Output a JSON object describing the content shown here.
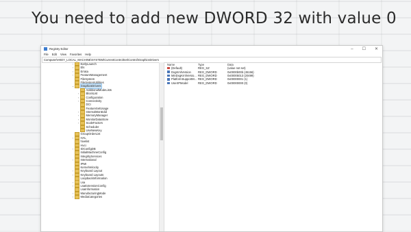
{
  "headline": "You need to add new DWORD 32 with value 0",
  "window": {
    "title": "Registry Editor",
    "controls": {
      "minimize": "–",
      "maximize": "☐",
      "close": "✕"
    },
    "menu": [
      "File",
      "Edit",
      "View",
      "Favorites",
      "Help"
    ],
    "address": "Computer\\HKEY_LOCAL_MACHINE\\SYSTEM\\CurrentControlSet\\Control\\GraphicsDrivers"
  },
  "tree": [
    {
      "label": "EarlyLaunch",
      "depth": 0,
      "expandable": true
    },
    {
      "label": "Els",
      "depth": 0,
      "expandable": true
    },
    {
      "label": "Errata",
      "depth": 0,
      "expandable": true
    },
    {
      "label": "FeatureManagement",
      "depth": 0,
      "expandable": true
    },
    {
      "label": "FileSystem",
      "depth": 0,
      "expandable": false
    },
    {
      "label": "FileSystemUtilities",
      "depth": 0,
      "expandable": false
    },
    {
      "label": "GraphicsDrivers",
      "depth": 0,
      "expandable": true,
      "expanded": true,
      "selected": true
    },
    {
      "label": "AdditionalModeLists",
      "depth": 1,
      "expandable": false
    },
    {
      "label": "BlockList",
      "depth": 1,
      "expandable": true
    },
    {
      "label": "Configuration",
      "depth": 1,
      "expandable": true
    },
    {
      "label": "Connectivity",
      "depth": 1,
      "expandable": true
    },
    {
      "label": "DCI",
      "depth": 1,
      "expandable": false
    },
    {
      "label": "FeatureSetUsage",
      "depth": 1,
      "expandable": false
    },
    {
      "label": "InternalMonEdid",
      "depth": 1,
      "expandable": true
    },
    {
      "label": "MemoryManager",
      "depth": 1,
      "expandable": true
    },
    {
      "label": "MonitorDataStore",
      "depth": 1,
      "expandable": true
    },
    {
      "label": "ScaleFactors",
      "depth": 1,
      "expandable": true
    },
    {
      "label": "Scheduler",
      "depth": 1,
      "expandable": false
    },
    {
      "label": "UseNewKey",
      "depth": 1,
      "expandable": false
    },
    {
      "label": "GroupOrderList",
      "depth": 0,
      "expandable": false
    },
    {
      "label": "HAL",
      "depth": 0,
      "expandable": true
    },
    {
      "label": "hivelist",
      "depth": 0,
      "expandable": false
    },
    {
      "label": "Hvci",
      "depth": 0,
      "expandable": false
    },
    {
      "label": "IDConfigDB",
      "depth": 0,
      "expandable": true
    },
    {
      "label": "InitialMachineConfig",
      "depth": 0,
      "expandable": false
    },
    {
      "label": "IntegrityServices",
      "depth": 0,
      "expandable": false
    },
    {
      "label": "International",
      "depth": 0,
      "expandable": true
    },
    {
      "label": "IPMI",
      "depth": 0,
      "expandable": false
    },
    {
      "label": "KernelVelocity",
      "depth": 0,
      "expandable": false
    },
    {
      "label": "Keyboard Layout",
      "depth": 0,
      "expandable": true
    },
    {
      "label": "Keyboard Layouts",
      "depth": 0,
      "expandable": true
    },
    {
      "label": "LoopbackInformation",
      "depth": 0,
      "expandable": false
    },
    {
      "label": "Lsa",
      "depth": 0,
      "expandable": true
    },
    {
      "label": "LsaExtensionConfig",
      "depth": 0,
      "expandable": true
    },
    {
      "label": "LsaInformation",
      "depth": 0,
      "expandable": false
    },
    {
      "label": "ManufacturingMode",
      "depth": 0,
      "expandable": true
    },
    {
      "label": "MediaCategories",
      "depth": 0,
      "expandable": true
    }
  ],
  "list": {
    "headers": {
      "name": "Name",
      "type": "Type",
      "data": "Data"
    },
    "rows": [
      {
        "name": "(Default)",
        "type": "REG_SZ",
        "data": "(value not set)",
        "kind": "sz"
      },
      {
        "name": "DxgKrnlVersion",
        "type": "REG_DWORD",
        "data": "0x0000b00b (45156)",
        "kind": "dw"
      },
      {
        "name": "MinDxgKrnlVersio...",
        "type": "REG_DWORD",
        "data": "0x00005013 (20499)",
        "kind": "dw"
      },
      {
        "name": "PlatformSupportM...",
        "type": "REG_DWORD",
        "data": "0x00000001 (1)",
        "kind": "dw"
      },
      {
        "name": "UseXPModel",
        "type": "REG_DWORD",
        "data": "0x00000000 (0)",
        "kind": "dw"
      }
    ]
  }
}
